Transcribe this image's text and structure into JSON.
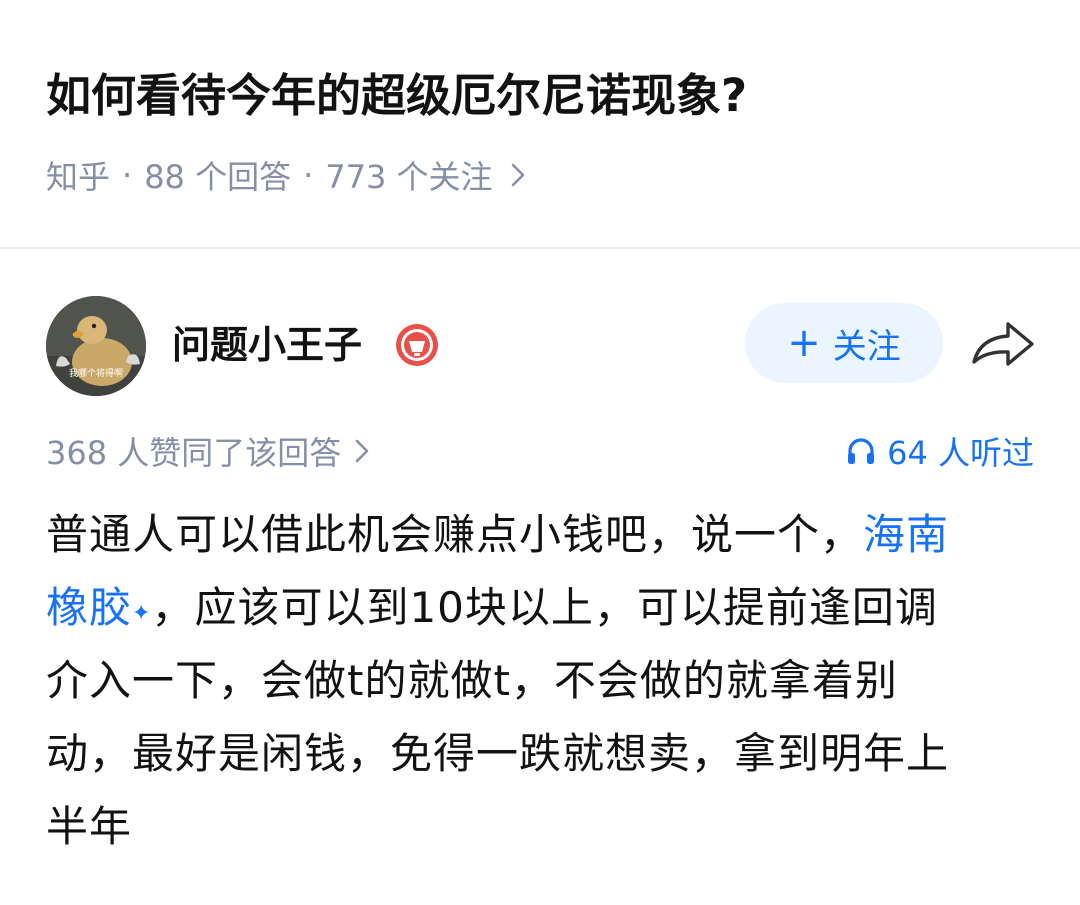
{
  "question": {
    "title": "如何看待今年的超级厄尔尼诺现象?",
    "source": "知乎",
    "separator": "·",
    "answer_count": "88 个回答",
    "follower_count": "773 个关注",
    "chevron_icon": "chevron-right-icon"
  },
  "author": {
    "name": "问题小王子",
    "avatar_caption": "我哪个将得啊",
    "badge_icon": "badge-icon",
    "follow_label": "关注",
    "follow_plus": "+",
    "share_icon": "share-icon"
  },
  "stats": {
    "votes": "368 人赞同了该回答",
    "listens": "64 人听过",
    "headphones_icon": "headphones-icon"
  },
  "answer": {
    "line1_text": "普通人可以借此机会赚点小钱吧，说一个，",
    "keyword_part1": "海南",
    "keyword_part2": "橡胶",
    "keyword_mark": "✦",
    "line2_text": "，应该可以到10块以上，可以提前逢回调",
    "line3_text": "介入一下，会做t的就做t，不会做的就拿着别",
    "line4_text": "动，最好是闲钱，免得一跌就想卖，拿到明年上",
    "line5_text": "半年"
  },
  "colors": {
    "link_blue": "#1772f6",
    "meta_gray": "#8590a6",
    "follow_bg": "#ebf5ff",
    "badge_red": "#e8514a"
  }
}
